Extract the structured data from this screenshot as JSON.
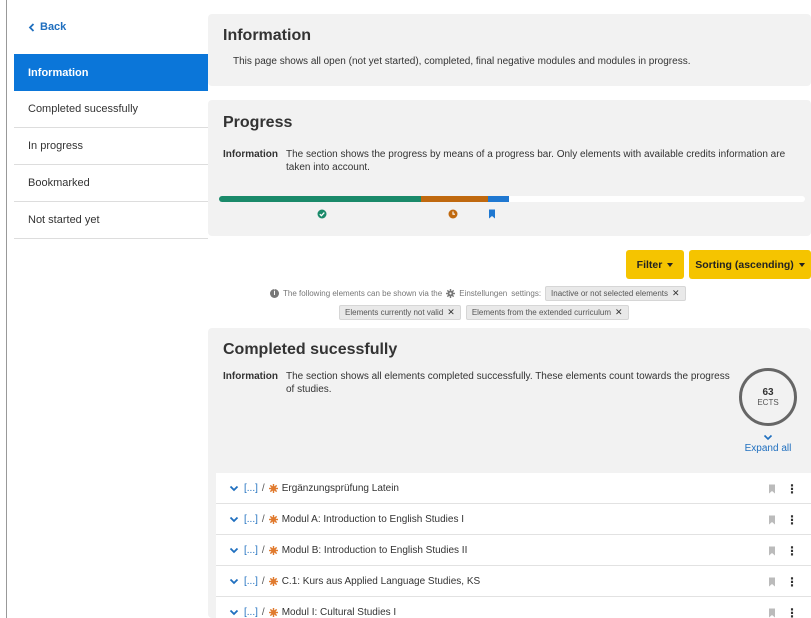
{
  "sidebar": {
    "back_label": "Back",
    "items": [
      {
        "label": "Information",
        "active": true
      },
      {
        "label": "Completed sucessfully",
        "active": false
      },
      {
        "label": "In progress",
        "active": false
      },
      {
        "label": "Bookmarked",
        "active": false
      },
      {
        "label": "Not started yet",
        "active": false
      }
    ]
  },
  "info": {
    "title": "Information",
    "text": "This page shows all open (not yet started), completed, final negative modules and modules in progress."
  },
  "progress": {
    "title": "Progress",
    "info_key": "Information",
    "info_text": "The section shows the progress by means of a progress bar. Only elements with available credits information are taken into account.",
    "segments": [
      {
        "status": "completed",
        "fraction": 0.345,
        "color": "#1a8a6a"
      },
      {
        "status": "in-progress",
        "fraction": 0.115,
        "color": "#c0690f"
      },
      {
        "status": "bookmarked",
        "fraction": 0.035,
        "color": "#1f78d1"
      }
    ],
    "marker_icons": [
      "check-circle-icon",
      "clock-icon",
      "bookmark-icon"
    ]
  },
  "toolbar": {
    "filter_label": "Filter",
    "sort_label": "Sorting (ascending)"
  },
  "hint": {
    "prefix": "The following elements can be shown via the",
    "settings_word": "Einstellungen",
    "suffix": "settings:",
    "chips": [
      "Inactive or not selected elements",
      "Elements currently not valid",
      "Elements from the extended curriculum"
    ]
  },
  "completed": {
    "title": "Completed sucessfully",
    "info_key": "Information",
    "info_text": "The section shows all elements completed successfully. These elements count towards the progress of studies.",
    "ects_value": "63",
    "ects_unit": "ECTS",
    "expand_label": "Expand all",
    "items": [
      {
        "path": "[...]",
        "name": "Ergänzungsprüfung Latein"
      },
      {
        "path": "[...]",
        "name": "Modul A: Introduction to English Studies I"
      },
      {
        "path": "[...]",
        "name": "Modul B: Introduction to English Studies II"
      },
      {
        "path": "[...]",
        "name": "C.1: Kurs aus Applied Language Studies, KS"
      },
      {
        "path": "[...]",
        "name": "Modul I: Cultural Studies I"
      }
    ]
  },
  "colors": {
    "accent": "#0b76d9",
    "button": "#f5c400",
    "gear": "#e07a2e"
  }
}
